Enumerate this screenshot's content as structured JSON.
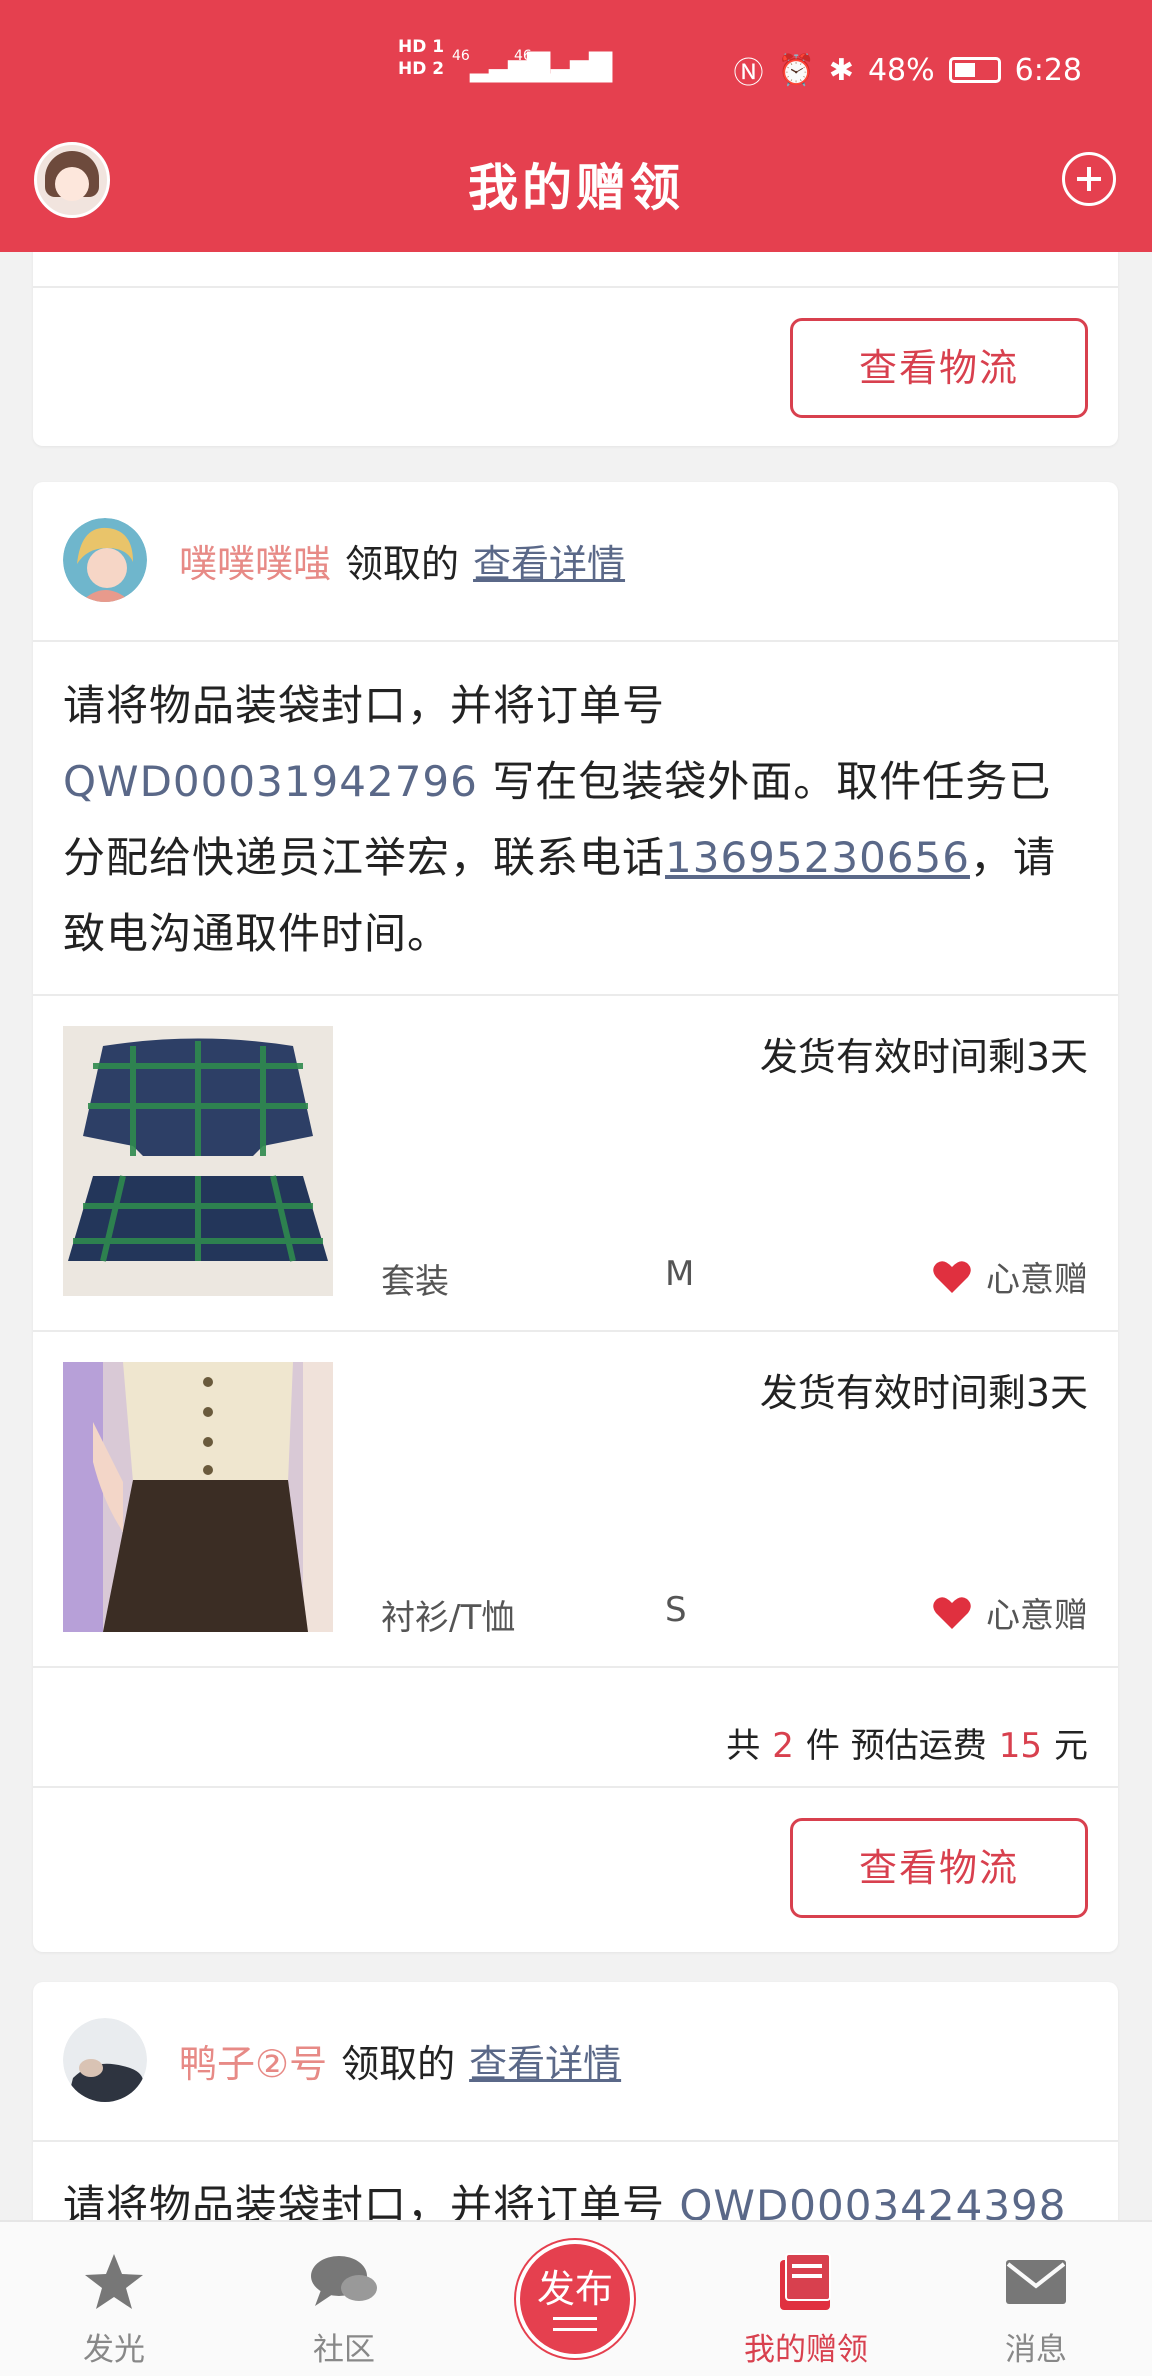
{
  "status_bar": {
    "sim1": "HD 1",
    "sim2": "HD 2",
    "net1": "46",
    "net2": "46",
    "battery": "48%",
    "time": "6:28"
  },
  "header": {
    "title": "我的赠领"
  },
  "buttons": {
    "logistics": "查看物流"
  },
  "orders": [
    {
      "user": "噗噗噗嗤",
      "claim_text": "领取的",
      "detail_link": "查看详情",
      "msg_part1": "请将物品装袋封口，并将订单号 ",
      "order_no": "QWD00031942796",
      "msg_part2": " 写在包装袋外面。取件任务已分配给快递员江举宏，联系电话",
      "phone": "13695230656",
      "msg_part3": "，请致电沟通取件时间。",
      "items": [
        {
          "deadline": "发货有效时间剩3天",
          "category": "套装",
          "size": "M",
          "gift_type": "心意赠"
        },
        {
          "deadline": "发货有效时间剩3天",
          "category": "衬衫/T恤",
          "size": "S",
          "gift_type": "心意赠"
        }
      ],
      "summary": {
        "prefix": "共",
        "count": "2",
        "mid": "件 预估运费",
        "fee": "15",
        "unit": "元"
      }
    },
    {
      "user": "鸭子②号",
      "claim_text": "领取的",
      "detail_link": "查看详情",
      "msg_part1": "请将物品装袋封口，并将订单号 ",
      "order_no": "QWD0003424398"
    }
  ],
  "nav": {
    "items": [
      {
        "label": "发光"
      },
      {
        "label": "社区"
      },
      {
        "label": "发布"
      },
      {
        "label": "我的赠领"
      },
      {
        "label": "消息"
      }
    ]
  },
  "colors": {
    "brand": "#e5404f",
    "accent_text": "#d8404e",
    "link": "#5a6888",
    "username": "#e78a86"
  }
}
